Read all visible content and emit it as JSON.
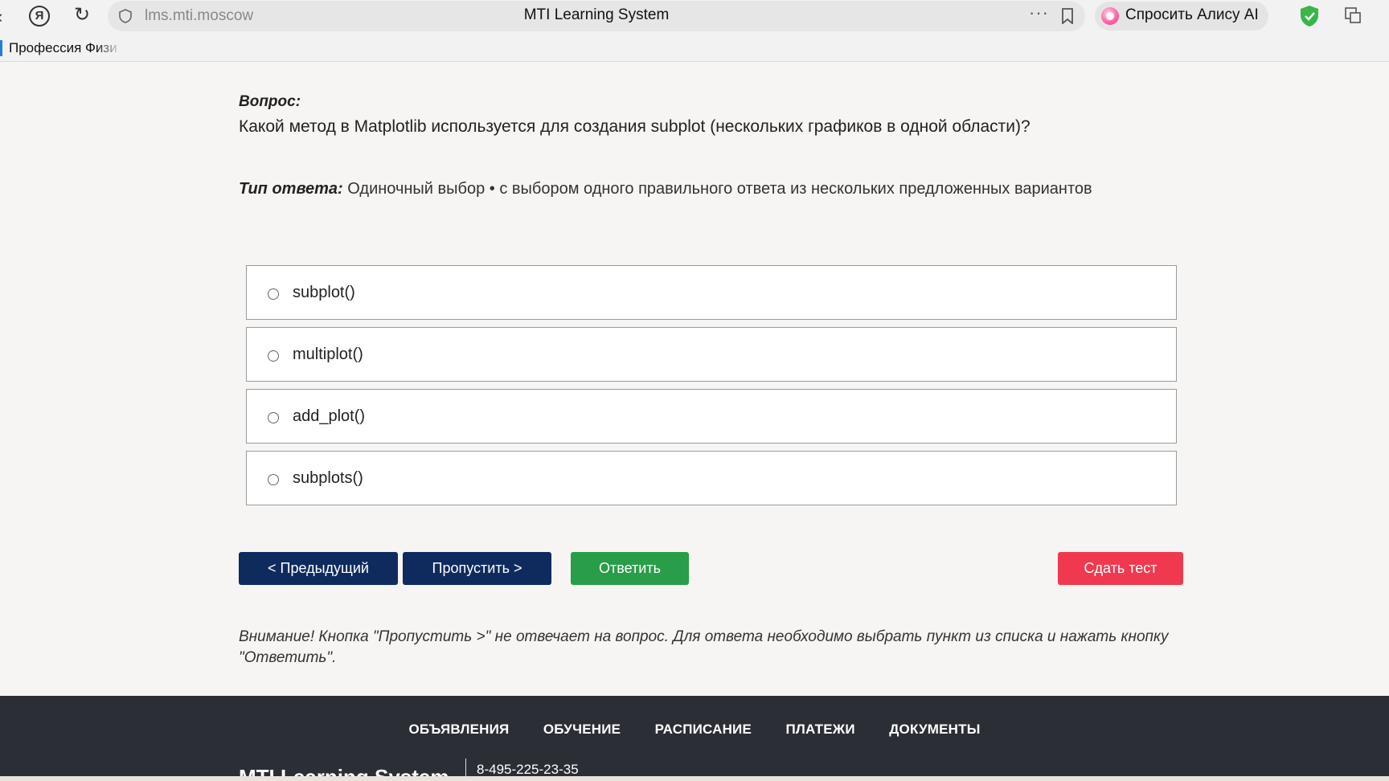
{
  "browser": {
    "back_icon": "arrow-left-icon",
    "yandex_label": "Я",
    "reload_icon": "reload-icon",
    "url": "lms.mti.moscow",
    "tab_title": "MTI Learning System",
    "more_label": "···",
    "alice_label": "Спросить Алису AI",
    "bookmark_item": "Профессия Физи"
  },
  "question": {
    "label": "Вопрос:",
    "text": "Какой метод в Matplotlib используется для создания subplot (нескольких графиков в одной области)?",
    "answer_type_label": "Тип ответа:",
    "answer_type_value": " Одиночный выбор • с выбором одного правильного ответа из нескольких предложенных вариантов"
  },
  "options": [
    {
      "label": "subplot()"
    },
    {
      "label": "multiplot()"
    },
    {
      "label": "add_plot()"
    },
    {
      "label": "subplots()"
    }
  ],
  "buttons": {
    "prev": "< Предыдущий",
    "skip": "Пропустить >",
    "answer": "Ответить",
    "submit": "Сдать тест"
  },
  "notice": "Внимание! Кнопка \"Пропустить >\" не отвечает на вопрос. Для ответа необходимо выбрать пункт из списка и нажать кнопку \"Ответить\".",
  "footer": {
    "nav": [
      "ОБЪЯВЛЕНИЯ",
      "ОБУЧЕНИЕ",
      "РАСПИСАНИЕ",
      "ПЛАТЕЖИ",
      "ДОКУМЕНТЫ"
    ],
    "brand": "MTI Learning System",
    "phone": "8-495-225-23-35"
  },
  "colors": {
    "primary_button": "#0f2b5e",
    "answer_button": "#2a9d48",
    "submit_button": "#f0394f",
    "footer_bg": "#2c2e36"
  }
}
